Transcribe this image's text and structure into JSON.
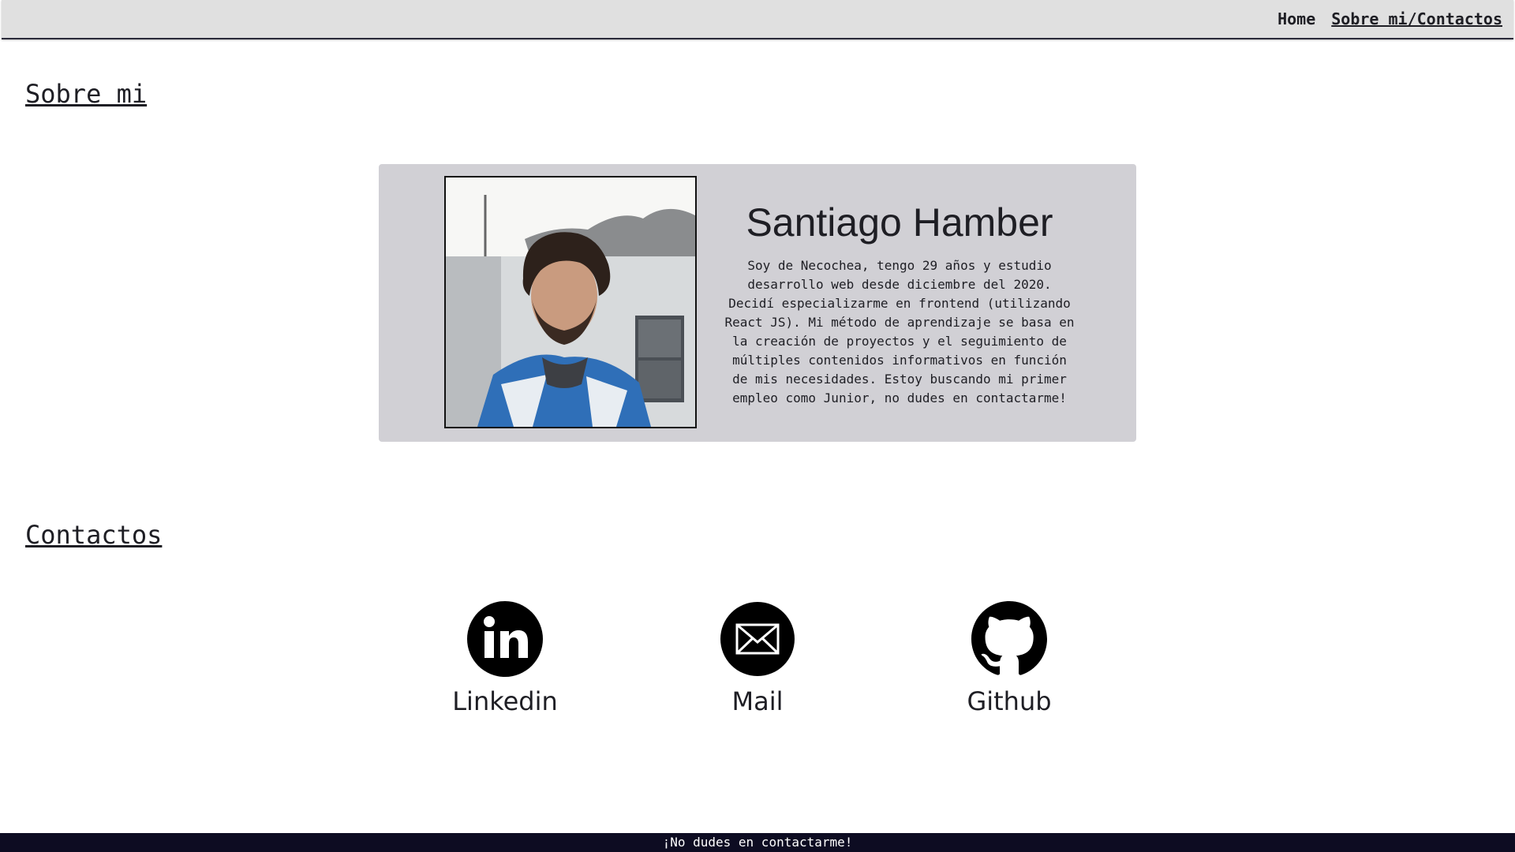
{
  "nav": {
    "home": "Home",
    "about_contacts": "Sobre mi/Contactos"
  },
  "about": {
    "title": "Sobre mi",
    "name": "Santiago Hamber",
    "bio": "Soy de Necochea, tengo 29 años y estudio desarrollo web desde diciembre del 2020. Decidí especializarme en frontend (utilizando React JS). Mi método de aprendizaje se basa en la creación de proyectos y el seguimiento de múltiples contenidos informativos en función de mis necesidades. Estoy buscando mi primer empleo como Junior, no dudes en contactarme!",
    "photo_icon": "profile-photo"
  },
  "contacts": {
    "title": "Contactos",
    "items": [
      {
        "label": "Linkedin",
        "icon": "linkedin-icon"
      },
      {
        "label": "Mail",
        "icon": "mail-icon"
      },
      {
        "label": "Github",
        "icon": "github-icon"
      }
    ]
  },
  "footer": {
    "text": "¡No dudes en contactarme!"
  },
  "colors": {
    "topbar": "#e0e0e0",
    "card": "#d1d0d5",
    "footer": "#0d0c22",
    "text": "#1e1e24"
  }
}
